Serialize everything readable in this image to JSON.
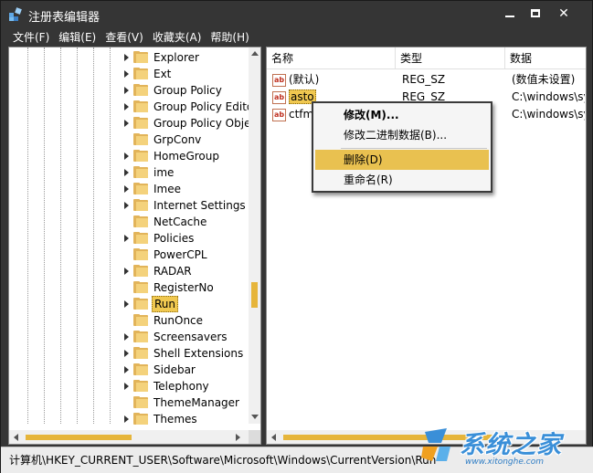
{
  "window": {
    "title": "注册表编辑器",
    "controls": {
      "minimize": "minimize",
      "maximize": "maximize",
      "close": "✕"
    }
  },
  "menubar": {
    "items": [
      "文件(F)",
      "编辑(E)",
      "查看(V)",
      "收藏夹(A)",
      "帮助(H)"
    ]
  },
  "tree": {
    "items": [
      {
        "label": "Explorer",
        "expandable": true
      },
      {
        "label": "Ext",
        "expandable": true
      },
      {
        "label": "Group Policy",
        "expandable": true
      },
      {
        "label": "Group Policy Editor",
        "expandable": true
      },
      {
        "label": "Group Policy Objects",
        "expandable": true
      },
      {
        "label": "GrpConv",
        "expandable": false
      },
      {
        "label": "HomeGroup",
        "expandable": true
      },
      {
        "label": "ime",
        "expandable": true
      },
      {
        "label": "Imee",
        "expandable": true
      },
      {
        "label": "Internet Settings",
        "expandable": true
      },
      {
        "label": "NetCache",
        "expandable": false
      },
      {
        "label": "Policies",
        "expandable": true
      },
      {
        "label": "PowerCPL",
        "expandable": false
      },
      {
        "label": "RADAR",
        "expandable": true
      },
      {
        "label": "RegisterNo",
        "expandable": false
      },
      {
        "label": "Run",
        "expandable": true,
        "selected": true
      },
      {
        "label": "RunOnce",
        "expandable": false
      },
      {
        "label": "Screensavers",
        "expandable": true
      },
      {
        "label": "Shell Extensions",
        "expandable": true
      },
      {
        "label": "Sidebar",
        "expandable": true
      },
      {
        "label": "Telephony",
        "expandable": true
      },
      {
        "label": "ThemeManager",
        "expandable": false
      },
      {
        "label": "Themes",
        "expandable": true
      }
    ]
  },
  "list": {
    "columns": [
      "名称",
      "类型",
      "数据"
    ],
    "rows": [
      {
        "name": "(默认)",
        "type": "REG_SZ",
        "data": "(数值未设置)",
        "icon": "ab"
      },
      {
        "name": "asto",
        "type": "REG_SZ",
        "data": "C:\\windows\\sys",
        "icon": "ab",
        "selected": true
      },
      {
        "name": "ctfmon",
        "type": "REG_SZ",
        "data": "C:\\windows\\sys",
        "icon": "ab"
      }
    ]
  },
  "context_menu": {
    "items": [
      {
        "label": "修改(M)...",
        "bold": true
      },
      {
        "label": "修改二进制数据(B)..."
      },
      {
        "label": "删除(D)",
        "highlighted": true
      },
      {
        "label": "重命名(R)"
      }
    ]
  },
  "status": {
    "path": "计算机\\HKEY_CURRENT_USER\\Software\\Microsoft\\Windows\\CurrentVersion\\Run"
  },
  "watermark": {
    "title": "系统之家",
    "url": "www.xitonghe.com"
  },
  "colors": {
    "chrome": "#353535",
    "accent": "#e6b53b",
    "highlight": "#e9c150",
    "folder": "#e2b45a"
  }
}
